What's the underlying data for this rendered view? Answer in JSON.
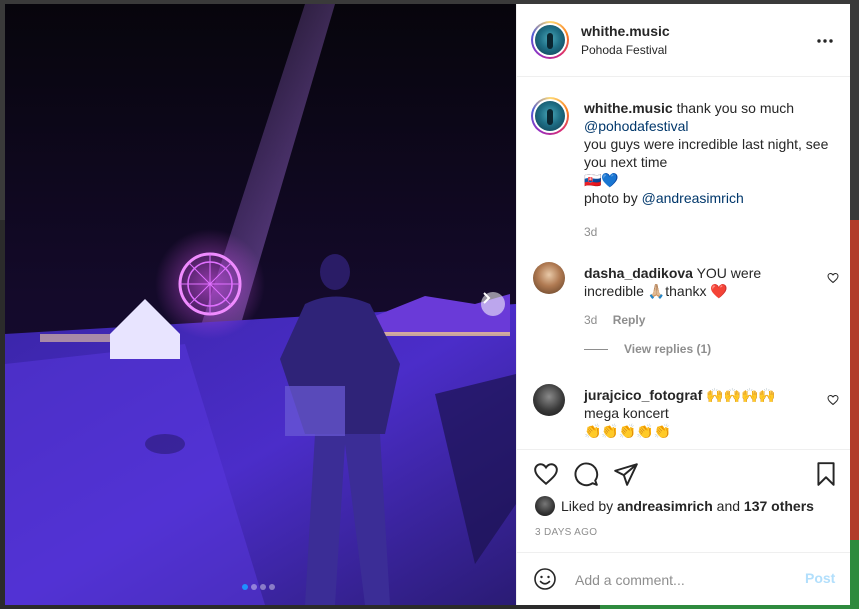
{
  "post": {
    "username": "whithe.music",
    "location": "Pohoda Festival",
    "caption": {
      "text_before_mention": "thank you so much",
      "mention": "@pohodafestival",
      "line2": "you guys were incredible last night, see you next time",
      "emojis": "🇸🇰💙",
      "photo_by_label": "photo by",
      "photo_by_mention": "@andreasimrich",
      "time": "3d"
    },
    "carousel": {
      "slide_count": 4,
      "active_index": 0
    }
  },
  "comments": [
    {
      "username": "dasha_dadikova",
      "text": "YOU were incredible 🙏🏼thankx ❤️",
      "time": "3d",
      "reply_label": "Reply",
      "view_replies": "View replies (1)"
    },
    {
      "username": "jurajcico_fotograf",
      "text_emojis": "🙌🙌🙌🙌",
      "text": "mega koncert",
      "text_emojis2": "👏👏👏👏👏"
    }
  ],
  "likes": {
    "prefix": "Liked by",
    "user": "andreasimrich",
    "joiner": "and",
    "others": "137 others"
  },
  "timestamp": "3 DAYS AGO",
  "comment_box": {
    "placeholder": "Add a comment...",
    "post_label": "Post"
  },
  "icons": {
    "more": "more-options-icon",
    "like": "heart-icon",
    "comment": "comment-icon",
    "share": "share-icon",
    "save": "bookmark-icon",
    "emoji": "smiley-icon",
    "next": "chevron-right-icon"
  },
  "colors": {
    "link": "#00376b",
    "post_disabled": "#b2dffc",
    "secondary": "#8e8e8e",
    "heart": "#ed4956"
  }
}
